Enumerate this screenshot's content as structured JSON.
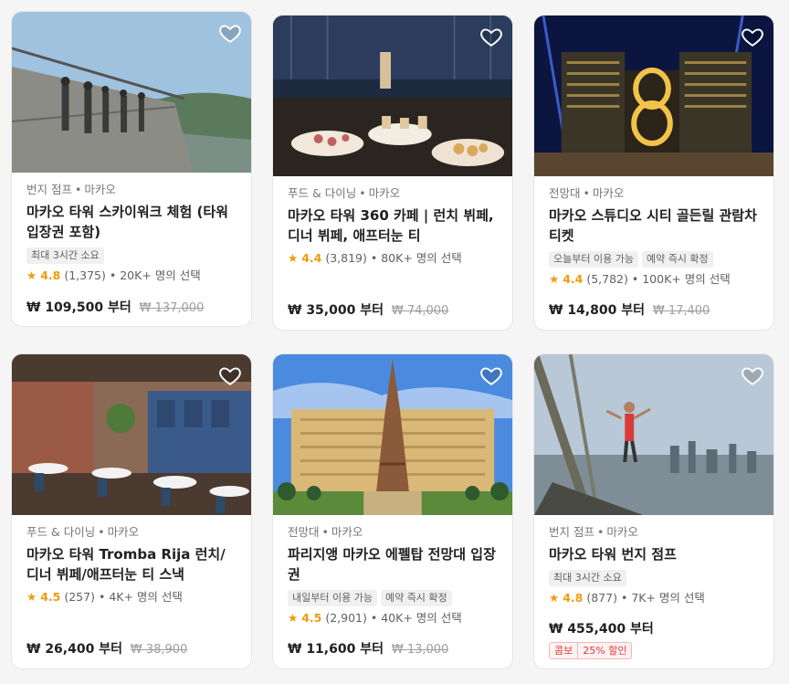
{
  "cards": [
    {
      "category": "번지 점프",
      "location": "마카오",
      "title": "마카오 타워 스카이워크 체험 (타워 입장권 포함)",
      "tags": [
        "최대 3시간 소요"
      ],
      "rating": "4.8",
      "reviews": "(1,375)",
      "booked": "20K+ 명의 선택",
      "price": "₩ 109,500 부터",
      "old_price": "₩ 137,000",
      "image_icon": "skywalk-photo"
    },
    {
      "category": "푸드 & 다이닝",
      "location": "마카오",
      "title": "마카오 타워 360 카페 | 런치 뷔페, 디너 뷔페, 애프터눈 티",
      "tags": [],
      "rating": "4.4",
      "reviews": "(3,819)",
      "booked": "80K+ 명의 선택",
      "price": "₩ 35,000 부터",
      "old_price": "₩ 74,000",
      "image_icon": "buffet-photo"
    },
    {
      "category": "전망대",
      "location": "마카오",
      "title": "마카오 스튜디오 시티 골든릴 관람차 티켓",
      "tags": [
        "오늘부터 이용 가능",
        "예약 즉시 확정"
      ],
      "rating": "4.4",
      "reviews": "(5,782)",
      "booked": "100K+ 명의 선택",
      "price": "₩ 14,800 부터",
      "old_price": "₩ 17,400",
      "image_icon": "studio-city-photo"
    },
    {
      "category": "푸드 & 다이닝",
      "location": "마카오",
      "title": "마카오 타워 Tromba Rija 런치/디너 뷔페/애프터눈 티 스낵",
      "tags": [],
      "rating": "4.5",
      "reviews": "(257)",
      "booked": "4K+ 명의 선택",
      "price": "₩ 26,400 부터",
      "old_price": "₩ 38,900",
      "image_icon": "restaurant-photo"
    },
    {
      "category": "전망대",
      "location": "마카오",
      "title": "파리지앵 마카오 에펠탑 전망대 입장권",
      "tags": [
        "내일부터 이용 가능",
        "예약 즉시 확정"
      ],
      "rating": "4.5",
      "reviews": "(2,901)",
      "booked": "40K+ 명의 선택",
      "price": "₩ 11,600 부터",
      "old_price": "₩ 13,000",
      "image_icon": "eiffel-photo"
    },
    {
      "category": "번지 점프",
      "location": "마카오",
      "title": "마카오 타워 번지 점프",
      "tags": [
        "최대 3시간 소요"
      ],
      "rating": "4.8",
      "reviews": "(877)",
      "booked": "7K+ 명의 선택",
      "price": "₩ 455,400 부터",
      "old_price": "",
      "promo": [
        "콤보",
        "25% 할인"
      ],
      "image_icon": "bungee-photo"
    }
  ],
  "colors": {
    "accent_star": "#f09b0a",
    "promo_red": "#e03b3b"
  }
}
